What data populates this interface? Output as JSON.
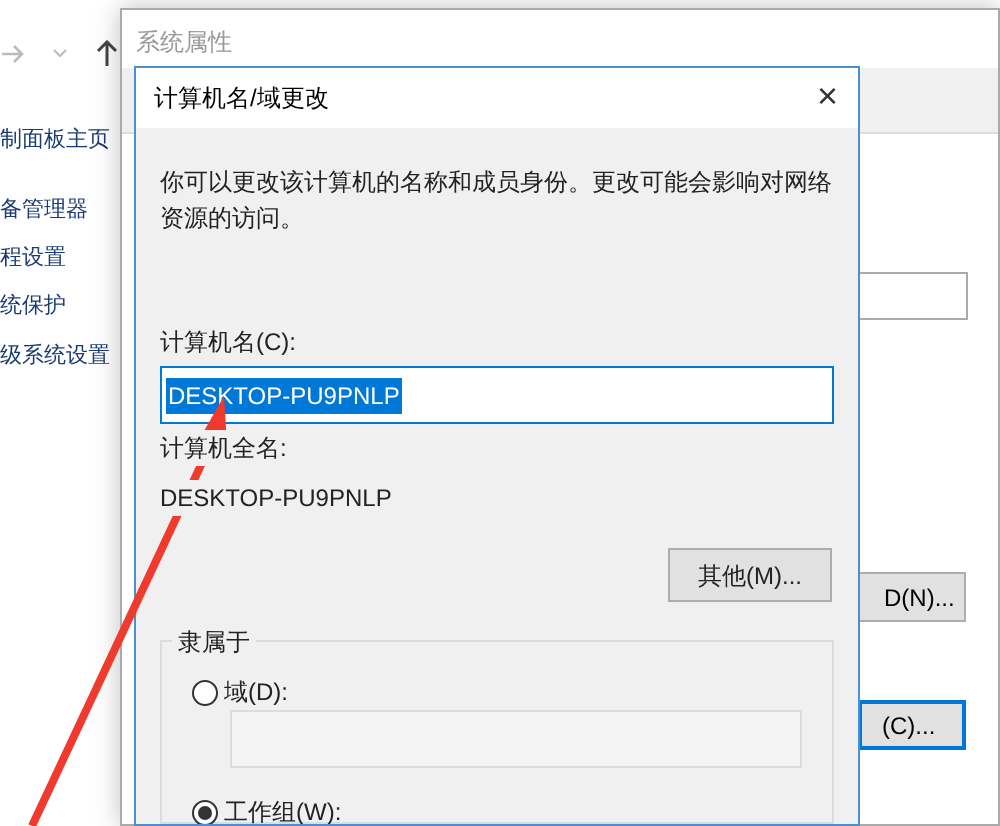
{
  "explorer": {
    "sidebar": {
      "items": [
        "制面板主页",
        "备管理器",
        "程设置",
        "统保护",
        "级系统设置"
      ]
    }
  },
  "system_properties": {
    "title": "系统属性",
    "buttons": [
      "D(N)...",
      "(C)..."
    ]
  },
  "dialog": {
    "title": "计算机名/域更改",
    "close": "×",
    "description": "你可以更改该计算机的名称和成员身份。更改可能会影响对网络资源的访问。",
    "computer_name": {
      "label": "计算机名(C):",
      "value": "DESKTOP-PU9PNLP"
    },
    "full_name": {
      "label": "计算机全名:",
      "value": "DESKTOP-PU9PNLP"
    },
    "more_button": "其他(M)...",
    "member_of": {
      "title": "隶属于",
      "options": [
        {
          "label": "域(D):",
          "selected": false
        },
        {
          "label": "工作组(W):",
          "selected": true
        }
      ]
    }
  }
}
